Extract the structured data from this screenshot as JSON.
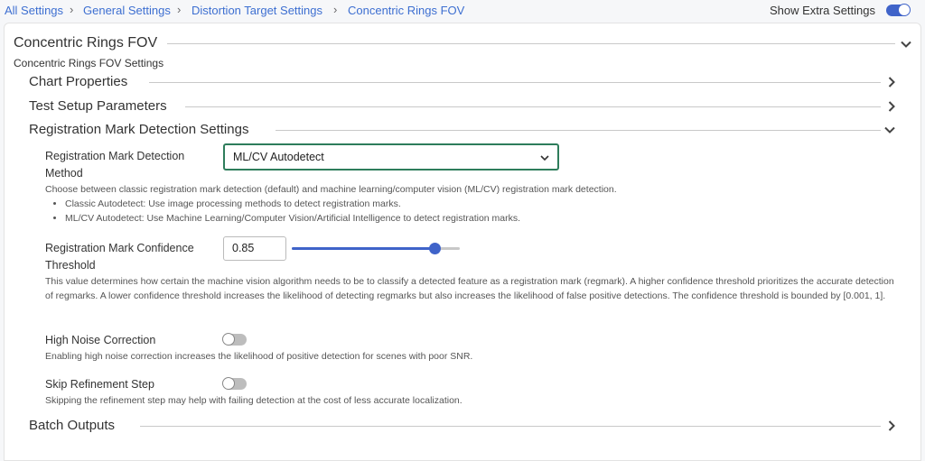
{
  "breadcrumb": {
    "items": [
      "All Settings",
      "General Settings",
      "Distortion Target Settings",
      "Concentric Rings FOV"
    ]
  },
  "header": {
    "extra_settings_label": "Show Extra Settings",
    "extra_settings_on": true
  },
  "panel": {
    "title": "Concentric Rings FOV",
    "subtitle": "Concentric Rings FOV Settings",
    "sections": {
      "chart_properties": "Chart Properties",
      "test_setup": "Test Setup Parameters",
      "registration": "Registration Mark Detection Settings",
      "batch_outputs": "Batch Outputs"
    }
  },
  "registration": {
    "method": {
      "label_line1": "Registration Mark Detection",
      "label_line2": "Method",
      "selected": "ML/CV Autodetect",
      "description": "Choose between classic registration mark detection (default) and machine learning/computer vision (ML/CV) registration mark detection.",
      "options_help": [
        "Classic Autodetect: Use image processing methods to detect registration marks.",
        "ML/CV Autodetect: Use Machine Learning/Computer Vision/Artificial Intelligence to detect registration marks."
      ]
    },
    "confidence": {
      "label_line1": "Registration Mark Confidence",
      "label_line2": "Threshold",
      "value": "0.85",
      "slider_fraction": 0.85,
      "description": "This value determines how certain the machine vision algorithm needs to be to classify a detected feature as a registration mark (regmark). A higher confidence threshold prioritizes the accurate detection of regmarks. A lower confidence threshold increases the likelihood of detecting regmarks but also increases the likelihood of false positive detections. The confidence threshold is bounded by [0.001, 1]."
    },
    "high_noise": {
      "label": "High Noise Correction",
      "enabled": false,
      "description": "Enabling high noise correction increases the likelihood of positive detection for scenes with poor SNR."
    },
    "skip_refinement": {
      "label": "Skip Refinement Step",
      "enabled": false,
      "description": "Skipping the refinement step may help with failing detection at the cost of less accurate localization."
    }
  },
  "colors": {
    "link": "#3d6fd1",
    "accent": "#3f63c9",
    "select_border": "#2e7d5b"
  }
}
